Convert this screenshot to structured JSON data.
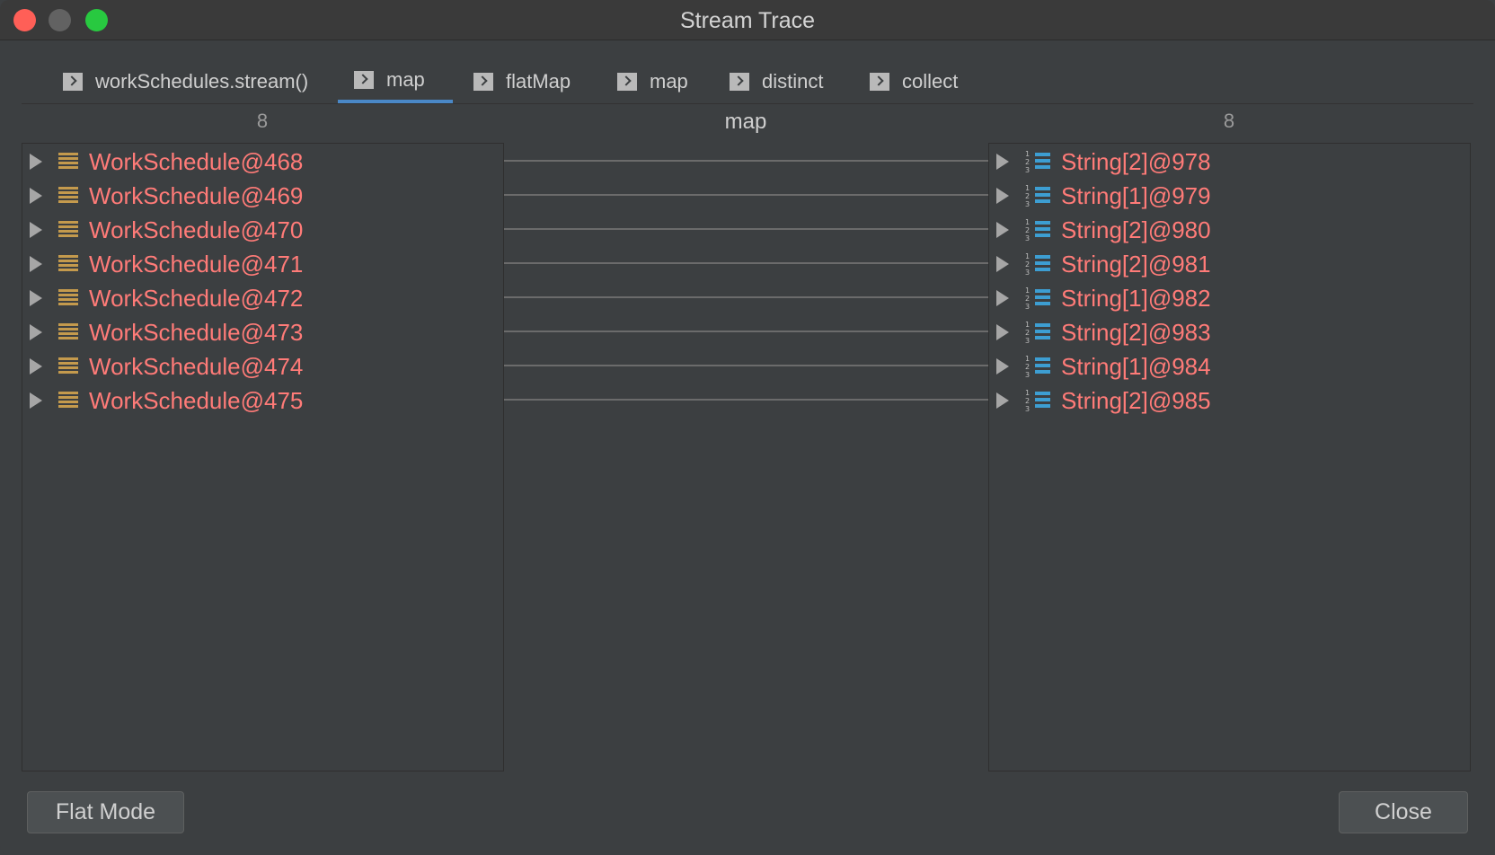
{
  "window": {
    "title": "Stream Trace"
  },
  "tabs": [
    {
      "label": "workSchedules.stream()",
      "active": false
    },
    {
      "label": "map",
      "active": true
    },
    {
      "label": "flatMap",
      "active": false
    },
    {
      "label": "map",
      "active": false
    },
    {
      "label": "distinct",
      "active": false
    },
    {
      "label": "collect",
      "active": false
    }
  ],
  "columns": {
    "left_count": "8",
    "middle_label": "map",
    "right_count": "8"
  },
  "left_items": [
    "WorkSchedule@468",
    "WorkSchedule@469",
    "WorkSchedule@470",
    "WorkSchedule@471",
    "WorkSchedule@472",
    "WorkSchedule@473",
    "WorkSchedule@474",
    "WorkSchedule@475"
  ],
  "right_items": [
    "String[2]@978",
    "String[1]@979",
    "String[2]@980",
    "String[2]@981",
    "String[1]@982",
    "String[2]@983",
    "String[1]@984",
    "String[2]@985"
  ],
  "icons": {
    "tab": "chevron-right-icon",
    "left_item": "object-icon",
    "right_item": "array-icon",
    "expand": "triangle-right-icon"
  },
  "buttons": {
    "flat_mode": "Flat Mode",
    "close": "Close"
  },
  "colors": {
    "item_text": "#ff7b78",
    "active_tab_underline": "#4a88c7",
    "object_icon": "#c49a4d",
    "array_icon": "#3d9ed2"
  }
}
